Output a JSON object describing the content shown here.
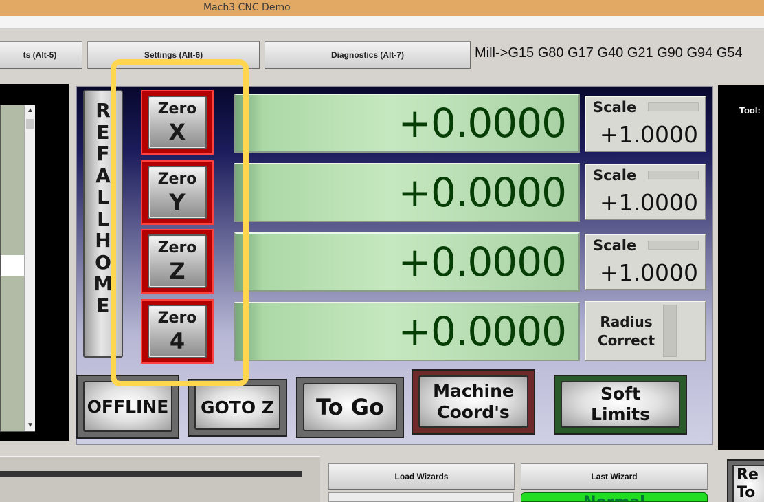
{
  "window": {
    "title": "Mach3 CNC  Demo"
  },
  "tabs": [
    {
      "label": "ts (Alt-5)"
    },
    {
      "label": "Settings (Alt-6)"
    },
    {
      "label": "Diagnostics (Alt-7)"
    }
  ],
  "modal_codes": "Mill->G15  G80 G17 G40 G21 G90 G94 G54",
  "ref_all_home": [
    "R",
    "E",
    "F",
    "A",
    "L",
    "L",
    "H",
    "O",
    "M",
    "E"
  ],
  "zero_buttons": [
    {
      "line1": "Zero",
      "line2": "X"
    },
    {
      "line1": "Zero",
      "line2": "Y"
    },
    {
      "line1": "Zero",
      "line2": "Z"
    },
    {
      "line1": "Zero",
      "line2": "4"
    }
  ],
  "axes": [
    {
      "value": "+0.0000"
    },
    {
      "value": "+0.0000"
    },
    {
      "value": "+0.0000"
    },
    {
      "value": "+0.0000"
    }
  ],
  "scales": [
    {
      "label": "Scale",
      "value": "+1.0000"
    },
    {
      "label": "Scale",
      "value": "+1.0000"
    },
    {
      "label": "Scale",
      "value": "+1.0000"
    }
  ],
  "radius_correct": {
    "line1": "Radius",
    "line2": "Correct"
  },
  "bottom_buttons": {
    "offline": "OFFLINE",
    "goto_z": "GOTO Z",
    "to_go": "To Go",
    "machine_coords_1": "Machine",
    "machine_coords_2": "Coord's",
    "soft_limits_1": "Soft",
    "soft_limits_2": "Limits"
  },
  "tool_label": "Tool:",
  "wizards": {
    "load": "Load Wizards",
    "last": "Last Wizard"
  },
  "normal": "Normal",
  "right_partial": {
    "line1": "Re",
    "line2": "To"
  },
  "colors": {
    "highlight": "#ffd64d",
    "dro_digits": "#053d05",
    "zero_border": "#b40000"
  }
}
